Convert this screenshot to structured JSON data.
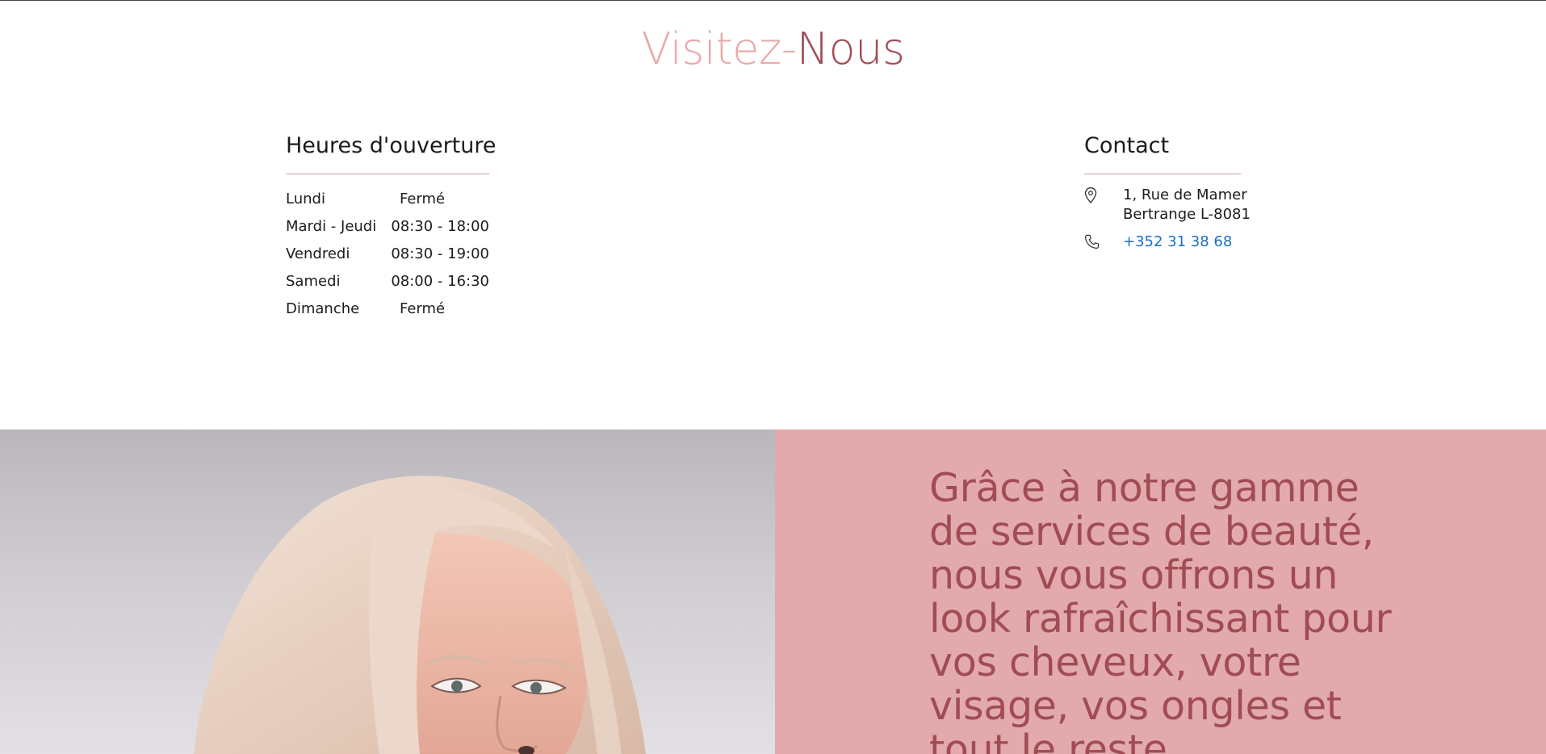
{
  "title": {
    "part1": "Visitez-",
    "part2": "Nous"
  },
  "hours": {
    "heading": "Heures d'ouverture",
    "rows": [
      {
        "day": "Lundi",
        "time": "Fermé"
      },
      {
        "day": "Mardi - Jeudi",
        "time": "08:30 - 18:00"
      },
      {
        "day": "Vendredi",
        "time": "08:30 - 19:00"
      },
      {
        "day": "Samedi",
        "time": "08:00 - 16:30"
      },
      {
        "day": "Dimanche",
        "time": "Fermé"
      }
    ]
  },
  "contact": {
    "heading": "Contact",
    "address_line1": "1, Rue de Mamer",
    "address_line2": "Bertrange L-8081",
    "phone": "+352 31 38 68",
    "address_icon": "map-pin-icon",
    "phone_icon": "phone-icon"
  },
  "banner": {
    "tagline": "Grâce à notre gamme de services de beauté, nous vous offrons un look rafraîchissant pour vos cheveux, votre visage, vos ongles et tout le reste."
  },
  "colors": {
    "accent_light": "#e8a9ab",
    "accent_dark": "#a14c55",
    "panel": "#e2aaac",
    "link": "#1e6fc7"
  }
}
